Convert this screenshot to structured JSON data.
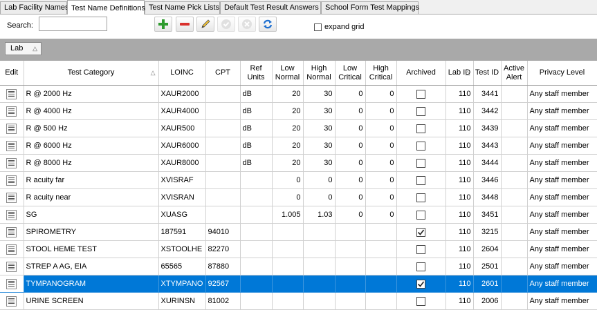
{
  "tabs": [
    {
      "label": "Lab Facility Names",
      "active": false
    },
    {
      "label": "Test Name Definitions",
      "active": true
    },
    {
      "label": "Test Name Pick Lists",
      "active": false
    },
    {
      "label": "Default Test Result Answers",
      "active": false
    },
    {
      "label": "School Form Test Mappings",
      "active": false
    }
  ],
  "toolbar": {
    "search_label": "Search:",
    "search_value": "",
    "buttons": [
      {
        "icon": "add-icon",
        "enabled": true
      },
      {
        "icon": "delete-icon",
        "enabled": true
      },
      {
        "icon": "edit-pencil-icon",
        "enabled": true
      },
      {
        "icon": "accept-check-icon",
        "enabled": false
      },
      {
        "icon": "cancel-x-icon",
        "enabled": false
      },
      {
        "icon": "refresh-icon",
        "enabled": true
      }
    ],
    "expand_grid_label": "expand grid",
    "expand_grid_checked": false
  },
  "group_by": {
    "label": "Lab"
  },
  "columns": [
    {
      "label": "Edit"
    },
    {
      "label": "Test Category",
      "sorted": true
    },
    {
      "label": "LOINC"
    },
    {
      "label": "CPT"
    },
    {
      "label": "Ref Units"
    },
    {
      "label": "Low Normal"
    },
    {
      "label": "High Normal"
    },
    {
      "label": "Low Critical"
    },
    {
      "label": "High Critical"
    },
    {
      "label": "Archived"
    },
    {
      "label": "Lab ID",
      "sorted": true
    },
    {
      "label": "Test ID"
    },
    {
      "label": "Active Alert"
    },
    {
      "label": "Privacy Level"
    }
  ],
  "rows": [
    {
      "category": "R @ 2000 Hz",
      "loinc": "XAUR2000",
      "cpt": "",
      "units": "dB",
      "low_normal": "20",
      "high_normal": "30",
      "low_critical": "0",
      "high_critical": "0",
      "archived": false,
      "lab_id": "110",
      "test_id": "3441",
      "active_alert": "",
      "privacy": "Any staff member",
      "selected": false
    },
    {
      "category": "R @ 4000 Hz",
      "loinc": "XAUR4000",
      "cpt": "",
      "units": "dB",
      "low_normal": "20",
      "high_normal": "30",
      "low_critical": "0",
      "high_critical": "0",
      "archived": false,
      "lab_id": "110",
      "test_id": "3442",
      "active_alert": "",
      "privacy": "Any staff member",
      "selected": false
    },
    {
      "category": "R @ 500 Hz",
      "loinc": "XAUR500",
      "cpt": "",
      "units": "dB",
      "low_normal": "20",
      "high_normal": "30",
      "low_critical": "0",
      "high_critical": "0",
      "archived": false,
      "lab_id": "110",
      "test_id": "3439",
      "active_alert": "",
      "privacy": "Any staff member",
      "selected": false
    },
    {
      "category": "R @ 6000 Hz",
      "loinc": "XAUR6000",
      "cpt": "",
      "units": "dB",
      "low_normal": "20",
      "high_normal": "30",
      "low_critical": "0",
      "high_critical": "0",
      "archived": false,
      "lab_id": "110",
      "test_id": "3443",
      "active_alert": "",
      "privacy": "Any staff member",
      "selected": false
    },
    {
      "category": "R @ 8000 Hz",
      "loinc": "XAUR8000",
      "cpt": "",
      "units": "dB",
      "low_normal": "20",
      "high_normal": "30",
      "low_critical": "0",
      "high_critical": "0",
      "archived": false,
      "lab_id": "110",
      "test_id": "3444",
      "active_alert": "",
      "privacy": "Any staff member",
      "selected": false
    },
    {
      "category": "R acuity far",
      "loinc": "XVISRAF",
      "cpt": "",
      "units": "",
      "low_normal": "0",
      "high_normal": "0",
      "low_critical": "0",
      "high_critical": "0",
      "archived": false,
      "lab_id": "110",
      "test_id": "3446",
      "active_alert": "",
      "privacy": "Any staff member",
      "selected": false
    },
    {
      "category": "R acuity near",
      "loinc": "XVISRAN",
      "cpt": "",
      "units": "",
      "low_normal": "0",
      "high_normal": "0",
      "low_critical": "0",
      "high_critical": "0",
      "archived": false,
      "lab_id": "110",
      "test_id": "3448",
      "active_alert": "",
      "privacy": "Any staff member",
      "selected": false
    },
    {
      "category": "SG",
      "loinc": "XUASG",
      "cpt": "",
      "units": "",
      "low_normal": "1.005",
      "high_normal": "1.03",
      "low_critical": "0",
      "high_critical": "0",
      "archived": false,
      "lab_id": "110",
      "test_id": "3451",
      "active_alert": "",
      "privacy": "Any staff member",
      "selected": false
    },
    {
      "category": "SPIROMETRY",
      "loinc": "187591",
      "cpt": "94010",
      "units": "",
      "low_normal": "",
      "high_normal": "",
      "low_critical": "",
      "high_critical": "",
      "archived": true,
      "lab_id": "110",
      "test_id": "3215",
      "active_alert": "",
      "privacy": "Any staff member",
      "selected": false
    },
    {
      "category": "STOOL HEME TEST",
      "loinc": "XSTOOLHE",
      "cpt": "82270",
      "units": "",
      "low_normal": "",
      "high_normal": "",
      "low_critical": "",
      "high_critical": "",
      "archived": false,
      "lab_id": "110",
      "test_id": "2604",
      "active_alert": "",
      "privacy": "Any staff member",
      "selected": false
    },
    {
      "category": "STREP A AG, EIA",
      "loinc": "65565",
      "cpt": "87880",
      "units": "",
      "low_normal": "",
      "high_normal": "",
      "low_critical": "",
      "high_critical": "",
      "archived": false,
      "lab_id": "110",
      "test_id": "2501",
      "active_alert": "",
      "privacy": "Any staff member",
      "selected": false
    },
    {
      "category": "TYMPANOGRAM",
      "loinc": "XTYMPANO",
      "cpt": "92567",
      "units": "",
      "low_normal": "",
      "high_normal": "",
      "low_critical": "",
      "high_critical": "",
      "archived": true,
      "lab_id": "110",
      "test_id": "2601",
      "active_alert": "",
      "privacy": "Any staff member",
      "selected": true
    },
    {
      "category": "URINE SCREEN",
      "loinc": "XURINSN",
      "cpt": "81002",
      "units": "",
      "low_normal": "",
      "high_normal": "",
      "low_critical": "",
      "high_critical": "",
      "archived": false,
      "lab_id": "110",
      "test_id": "2006",
      "active_alert": "",
      "privacy": "Any staff member",
      "selected": false
    }
  ],
  "colors": {
    "selection": "#0078d7",
    "group_bar": "#a9a9a9",
    "add_green": "#2e9b2e",
    "delete_red": "#d9302c",
    "refresh_blue": "#1e6fd0"
  }
}
